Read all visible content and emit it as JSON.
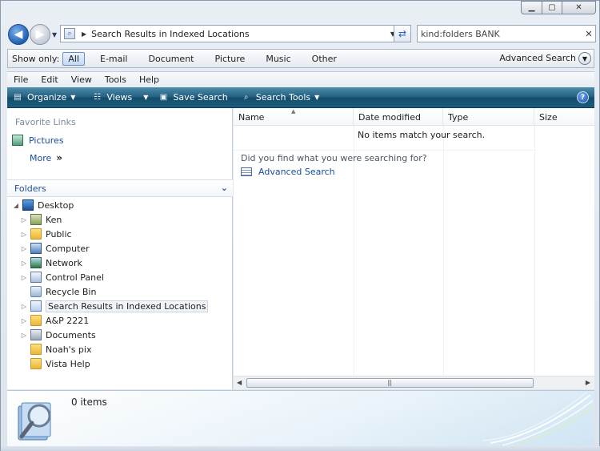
{
  "address": {
    "path": "Search Results in Indexed Locations"
  },
  "search": {
    "value": "kind:folders BANK"
  },
  "show_only": {
    "label": "Show only:",
    "filters": [
      "All",
      "E-mail",
      "Document",
      "Picture",
      "Music",
      "Other"
    ],
    "active": "All",
    "advanced_label": "Advanced Search"
  },
  "menu": [
    "File",
    "Edit",
    "View",
    "Tools",
    "Help"
  ],
  "commands": {
    "organize": "Organize",
    "views": "Views",
    "save_search": "Save Search",
    "search_tools": "Search Tools"
  },
  "favorites": {
    "title": "Favorite Links",
    "items": [
      "Pictures"
    ],
    "more": "More"
  },
  "folders": {
    "title": "Folders",
    "tree": [
      {
        "label": "Desktop",
        "icon": "desktop-icon"
      },
      {
        "label": "Ken",
        "icon": "user-folder-icon"
      },
      {
        "label": "Public",
        "icon": "folder-icon"
      },
      {
        "label": "Computer",
        "icon": "computer-icon"
      },
      {
        "label": "Network",
        "icon": "network-icon"
      },
      {
        "label": "Control Panel",
        "icon": "control-panel-icon"
      },
      {
        "label": "Recycle Bin",
        "icon": "recycle-bin-icon"
      },
      {
        "label": "Search Results in Indexed Locations",
        "icon": "search-folder-icon"
      },
      {
        "label": "A&P 2221",
        "icon": "folder-icon"
      },
      {
        "label": "Documents",
        "icon": "documents-icon"
      },
      {
        "label": "Noah's pix",
        "icon": "folder-icon"
      },
      {
        "label": "Vista Help",
        "icon": "folder-icon"
      }
    ]
  },
  "columns": [
    "Name",
    "Date modified",
    "Type",
    "Size"
  ],
  "content": {
    "empty_message": "No items match your search.",
    "prompt": "Did you find what you were searching for?",
    "advanced_link": "Advanced Search"
  },
  "details": {
    "count": "0 items"
  },
  "colors": {
    "command_bar": "#245f80",
    "link": "#1a4b9b",
    "accent": "#1f5fb5"
  }
}
